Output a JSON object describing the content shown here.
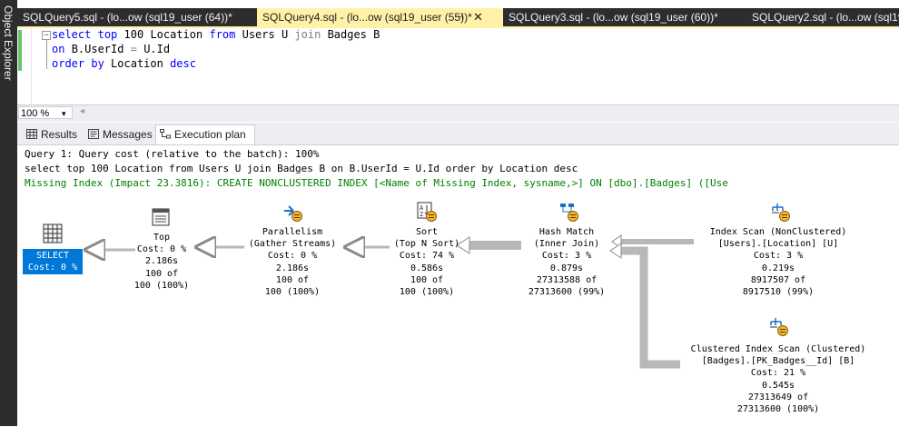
{
  "sidebar": {
    "label": "Object Explorer"
  },
  "tabs": [
    {
      "label": "SQLQuery5.sql - (lo...ow (sql19_user (64))*",
      "active": false
    },
    {
      "label": "SQLQuery4.sql - (lo...ow (sql19_user (55))*",
      "active": true
    },
    {
      "label": "SQLQuery3.sql - (lo...ow (sql19_user (60))*",
      "active": false
    },
    {
      "label": "SQLQuery2.sql - (lo...ow (sql19",
      "active": false
    }
  ],
  "tab_controls": {
    "pin": "⊣",
    "close": "✕"
  },
  "editor": {
    "fold_glyph": "−",
    "line1": {
      "k1": "select",
      "k2": "top",
      "n": "100",
      "c1": "Location",
      "k3": "from",
      "t1": "Users U",
      "k4": "join",
      "t2": "Badges B"
    },
    "line2": {
      "k1": "on",
      "t1": "B.UserId",
      "op": "=",
      "t2": "U.Id"
    },
    "line3": {
      "k1": "order",
      "k2": "by",
      "c1": "Location",
      "k3": "desc"
    }
  },
  "zoom": {
    "value": "100 %",
    "arrow": "▾",
    "scroll": "◂"
  },
  "result_tabs": [
    {
      "label": "Results",
      "icon": "grid-icon"
    },
    {
      "label": "Messages",
      "icon": "messages-icon"
    },
    {
      "label": "Execution plan",
      "icon": "execution-plan-icon"
    }
  ],
  "plan_header": {
    "line1": "Query 1: Query cost (relative to the batch): 100%",
    "line2": "select top 100 Location from Users U join Badges B on B.UserId = U.Id order by Location desc",
    "missing_index": "Missing Index (Impact 23.3816): CREATE NONCLUSTERED INDEX [<Name of Missing Index, sysname,>] ON [dbo].[Badges] ([Use"
  },
  "colors": {
    "missing_index": "#008000",
    "select_box": "#0078d7",
    "active_tab": "#fff1a8"
  },
  "nodes": {
    "select": {
      "l1": "SELECT",
      "l2": "Cost: 0 %"
    },
    "top": {
      "l1": "Top",
      "l2": "Cost: 0 %",
      "l3": "2.186s",
      "l4": "100 of",
      "l5": "100 (100%)"
    },
    "parallelism": {
      "l1": "Parallelism",
      "l2": "(Gather Streams)",
      "l3": "Cost: 0 %",
      "l4": "2.186s",
      "l5": "100 of",
      "l6": "100 (100%)"
    },
    "sort": {
      "l1": "Sort",
      "l2": "(Top N Sort)",
      "l3": "Cost: 74 %",
      "l4": "0.586s",
      "l5": "100 of",
      "l6": "100 (100%)"
    },
    "hash": {
      "l1": "Hash Match",
      "l2": "(Inner Join)",
      "l3": "Cost: 3 %",
      "l4": "0.879s",
      "l5": "27313588 of",
      "l6": "27313600 (99%)"
    },
    "index": {
      "l1": "Index Scan (NonClustered)",
      "l2": "[Users].[Location] [U]",
      "l3": "Cost: 3 %",
      "l4": "0.219s",
      "l5": "8917507 of",
      "l6": "8917510 (99%)"
    },
    "clustered": {
      "l1": "Clustered Index Scan (Clustered)",
      "l2": "[Badges].[PK_Badges__Id] [B]",
      "l3": "Cost: 21 %",
      "l4": "0.545s",
      "l5": "27313649 of",
      "l6": "27313600 (100%)"
    }
  }
}
